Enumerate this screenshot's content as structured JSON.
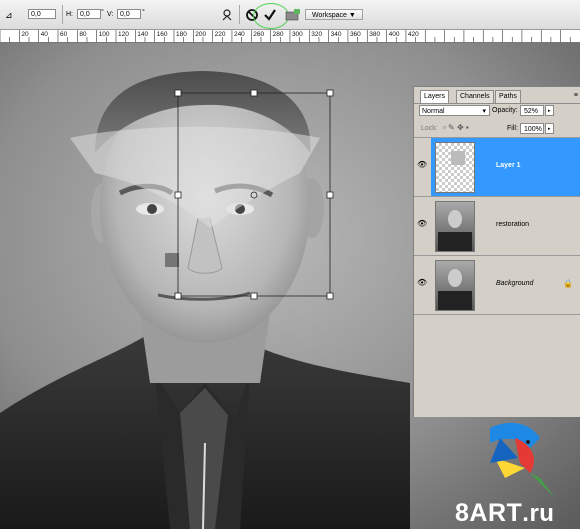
{
  "options_bar": {
    "angle_value": "0,0",
    "h_label": "H:",
    "h_value": "0,0",
    "h_unit": "°",
    "v_label": "V:",
    "v_value": "0,0",
    "v_unit": "°",
    "workspace_label": "Workspace ▼",
    "icons": [
      "angle-icon",
      "warp-mode-icon",
      "cancel-transform-icon",
      "commit-transform-icon",
      "file-browser-icon"
    ]
  },
  "ruler": {
    "labels": [
      "20",
      "40",
      "60",
      "80",
      "100",
      "120",
      "140",
      "160",
      "180",
      "200",
      "220",
      "240",
      "260",
      "280",
      "300",
      "320",
      "340",
      "360",
      "380",
      "400",
      "420"
    ]
  },
  "layers_panel": {
    "tabs": [
      "Layers",
      "Channels",
      "Paths"
    ],
    "active_tab": "Layers",
    "blend_mode": "Normal",
    "opacity_label": "Opacity:",
    "opacity_value": "52%",
    "lock_label": "Lock:",
    "fill_label": "Fill:",
    "fill_value": "100%",
    "layers": [
      {
        "name": "Layer 1",
        "selected": true,
        "italic": false
      },
      {
        "name": "restoration",
        "selected": false,
        "italic": false
      },
      {
        "name": "Background",
        "selected": false,
        "italic": true,
        "locked": true
      }
    ]
  },
  "watermark": {
    "text": "8ART",
    "suffix": ".ru"
  },
  "colors": {
    "selection_blue": "#3399ff",
    "panel_gray": "#d4d0c8",
    "commit_highlight": "#4fd14f"
  }
}
